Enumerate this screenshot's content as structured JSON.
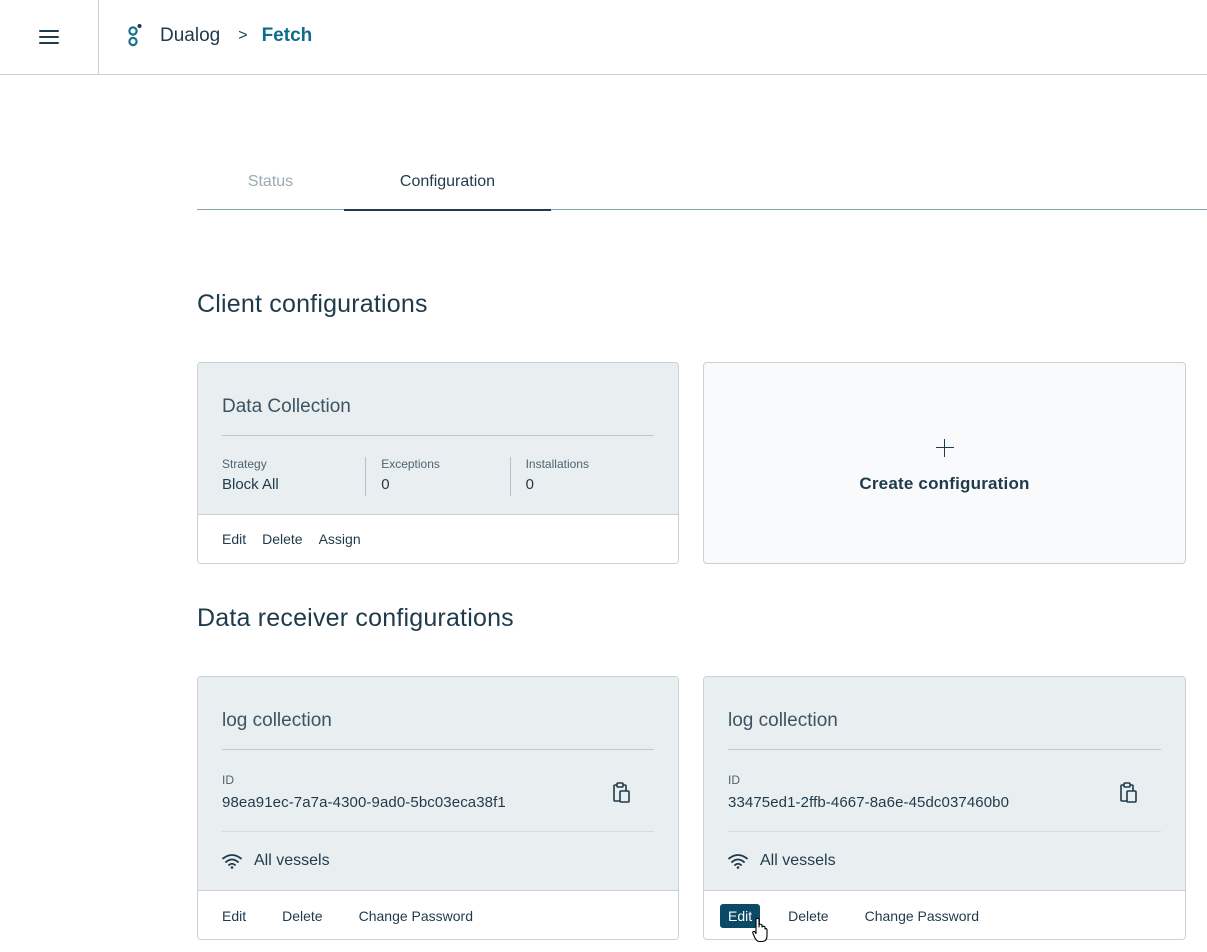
{
  "header": {
    "brand": "Dualog",
    "separator": ">",
    "current": "Fetch"
  },
  "tabs": [
    {
      "label": "Status",
      "active": false
    },
    {
      "label": "Configuration",
      "active": true
    }
  ],
  "client_section": {
    "title": "Client configurations",
    "cards": [
      {
        "title": "Data Collection",
        "stats": [
          {
            "label": "Strategy",
            "value": "Block All"
          },
          {
            "label": "Exceptions",
            "value": "0"
          },
          {
            "label": "Installations",
            "value": "0"
          }
        ],
        "actions": [
          "Edit",
          "Delete",
          "Assign"
        ]
      }
    ],
    "create_label": "Create configuration"
  },
  "receiver_section": {
    "title": "Data receiver configurations",
    "cards": [
      {
        "title": "log collection",
        "id_label": "ID",
        "id_value": "98ea91ec-7a7a-4300-9ad0-5bc03eca38f1",
        "vessels": "All vessels",
        "actions": [
          "Edit",
          "Delete",
          "Change Password"
        ]
      },
      {
        "title": "log collection",
        "id_label": "ID",
        "id_value": "33475ed1-2ffb-4667-8a6e-45dc037460b0",
        "vessels": "All vessels",
        "actions": [
          "Edit",
          "Delete",
          "Change Password"
        ]
      }
    ]
  },
  "colors": {
    "primary": "#1f3a4a",
    "accent": "#0d6e8c",
    "card_bg": "#e9eef1",
    "active_button": "#0b4a66"
  },
  "icons": [
    "menu-icon",
    "dualog-logo-icon",
    "copy-icon",
    "wifi-icon",
    "plus-icon",
    "hand-cursor-icon"
  ]
}
